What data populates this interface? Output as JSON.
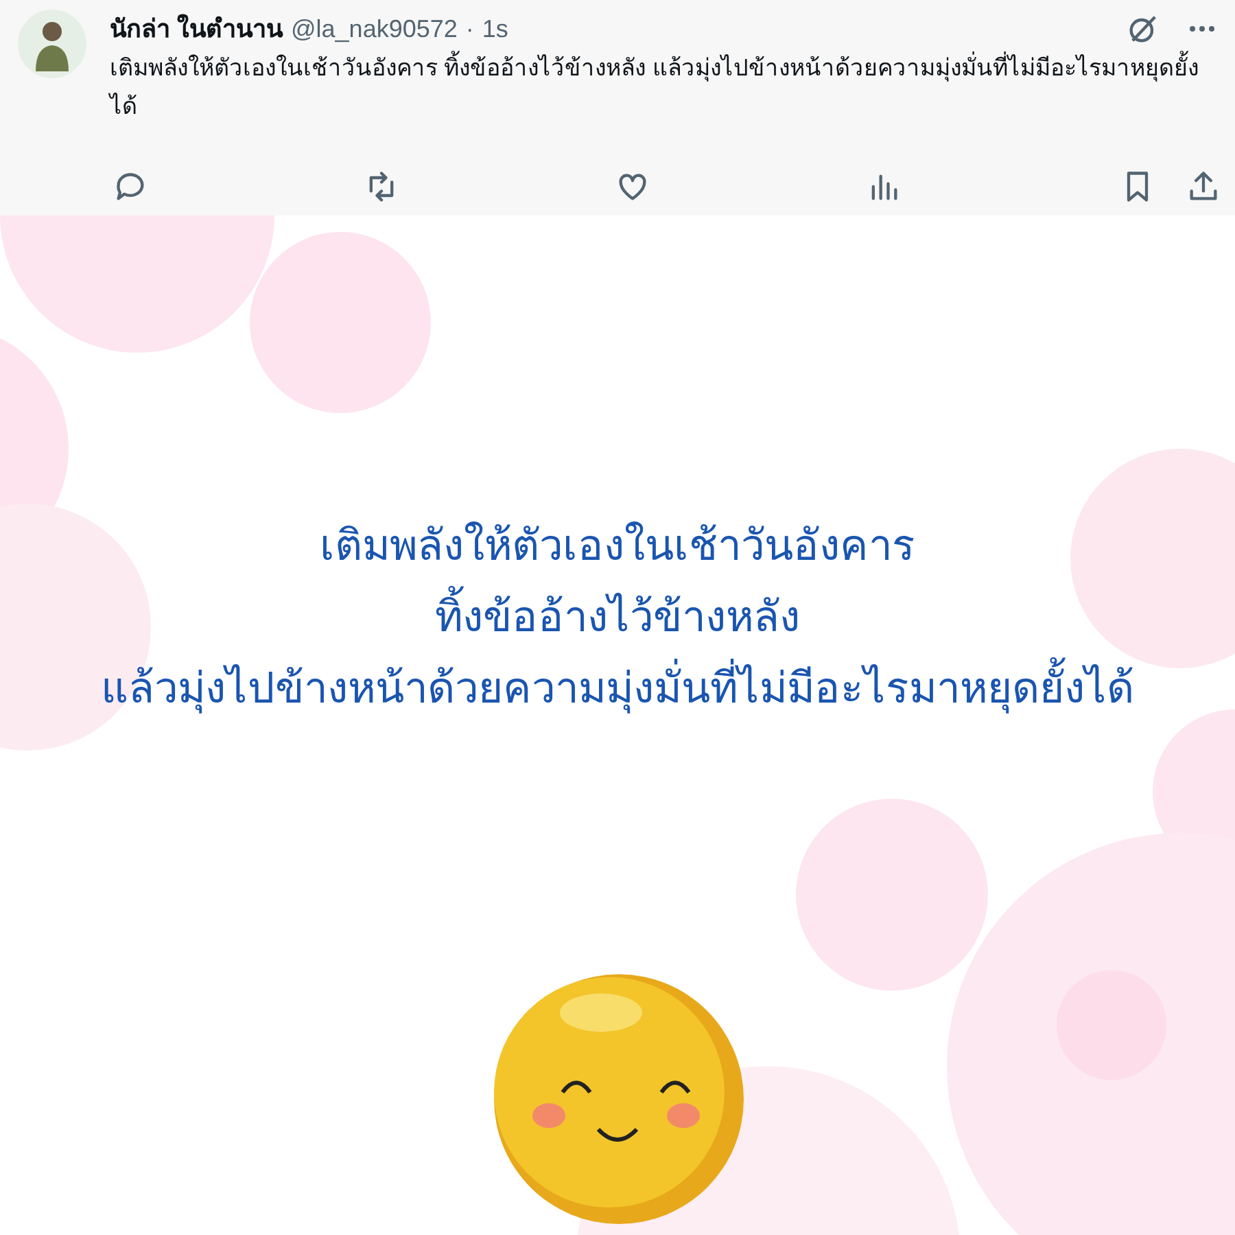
{
  "post": {
    "author": "นักล่า ในตำนาน",
    "handle": "@la_nak90572",
    "separator": "·",
    "time": "1s",
    "text": "เติมพลังให้ตัวเองในเช้าวันอังคาร ทิ้งข้ออ้างไว้ข้างหลัง แล้วมุ่งไปข้างหน้าด้วยความมุ่งมั่นที่ไม่มีอะไรมาหยุดยั้งได้",
    "actions": [
      {
        "kind": "reply"
      },
      {
        "kind": "repost"
      },
      {
        "kind": "like"
      },
      {
        "kind": "views"
      },
      {
        "kind": "bookmark"
      },
      {
        "kind": "share"
      }
    ]
  },
  "image": {
    "lines": [
      "เติมพลังให้ตัวเองในเช้าวันอังคาร",
      "ทิ้งข้ออ้างไว้ข้างหลัง",
      "แล้วมุ่งไปข้างหน้าด้วยความมุ่งมั่นที่ไม่มีอะไรมาหยุดยั้งได้"
    ]
  }
}
